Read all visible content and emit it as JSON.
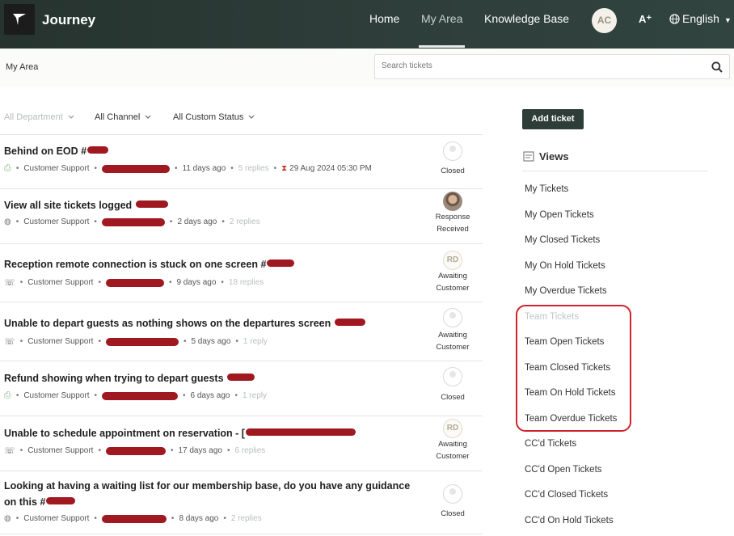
{
  "header": {
    "brand": "Journey",
    "nav": [
      "Home",
      "My Area",
      "Knowledge Base"
    ],
    "active_nav": "My Area",
    "avatar_initials": "AC",
    "font_size_icon": "A⁺",
    "language": "English"
  },
  "subheader": {
    "breadcrumb": "My Area",
    "search_placeholder": "Search tickets"
  },
  "filters": [
    "All Department",
    "All Channel",
    "All Custom Status"
  ],
  "tickets": [
    {
      "title": "Behind on EOD #",
      "channel_icon": "web-form-icon",
      "department": "Customer Support",
      "age": "11 days ago",
      "replies": "5 replies",
      "due": "29 Aug 2024 05:30 PM",
      "status": "Closed",
      "status_avatar": "blank"
    },
    {
      "title": "View all site tickets logged",
      "channel_icon": "globe-icon",
      "department": "Customer Support",
      "age": "2 days ago",
      "replies": "2 replies",
      "status": "Response Received",
      "status_avatar": "photo"
    },
    {
      "title": "Reception remote connection is stuck on one screen #",
      "channel_icon": "phone-icon",
      "department": "Customer Support",
      "age": "9 days ago",
      "replies": "18 replies",
      "status": "Awaiting Customer",
      "status_avatar": "RD"
    },
    {
      "title": "Unable to depart guests as nothing shows on the departures screen",
      "channel_icon": "phone-icon",
      "department": "Customer Support",
      "age": "5 days ago",
      "replies": "1 reply",
      "status": "Awaiting Customer",
      "status_avatar": "blank"
    },
    {
      "title": "Refund showing when trying to depart guests",
      "channel_icon": "web-form-icon",
      "department": "Customer Support",
      "age": "6 days ago",
      "replies": "1 reply",
      "status": "Closed",
      "status_avatar": "blank"
    },
    {
      "title": "Unable to schedule appointment on reservation - [",
      "channel_icon": "phone-icon",
      "department": "Customer Support",
      "age": "17 days ago",
      "replies": "6 replies",
      "status": "Awaiting Customer",
      "status_avatar": "RD"
    },
    {
      "title": "Looking at having a waiting list for our membership base, do you have any guidance on this #",
      "channel_icon": "globe-icon",
      "department": "Customer Support",
      "age": "8 days ago",
      "replies": "2 replies",
      "status": "Closed",
      "status_avatar": "blank"
    }
  ],
  "sidebar": {
    "add_ticket": "Add ticket",
    "views_title": "Views",
    "views": [
      "My Tickets",
      "My Open Tickets",
      "My Closed Tickets",
      "My On Hold Tickets",
      "My Overdue Tickets",
      "Team Tickets",
      "Team Open Tickets",
      "Team Closed Tickets",
      "Team On Hold Tickets",
      "Team Overdue Tickets",
      "CC'd Tickets",
      "CC'd Open Tickets",
      "CC'd Closed Tickets",
      "CC'd On Hold Tickets"
    ]
  },
  "colors": {
    "header_bg": "#2b3a36",
    "button_bg": "#2f3d39",
    "highlight": "#d0232b",
    "redaction": "#a01820"
  }
}
